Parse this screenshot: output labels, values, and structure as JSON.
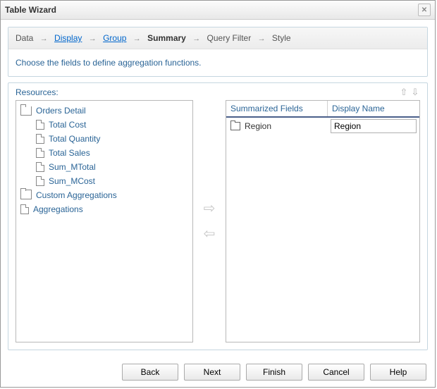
{
  "window": {
    "title": "Table Wizard"
  },
  "breadcrumb": {
    "data": "Data",
    "display": "Display",
    "group": "Group",
    "summary": "Summary",
    "query_filter": "Query Filter",
    "style": "Style"
  },
  "instruction": "Choose the fields to define aggregation functions.",
  "resources_label": "Resources:",
  "tree": {
    "orders_detail": "Orders Detail",
    "items": [
      "Total Cost",
      "Total Quantity",
      "Total Sales",
      "Sum_MTotal",
      "Sum_MCost"
    ],
    "custom_aggregations": "Custom Aggregations",
    "aggregations": "Aggregations"
  },
  "table": {
    "header_summarized": "Summarized Fields",
    "header_display": "Display Name",
    "rows": [
      {
        "field": "Region",
        "display": "Region"
      }
    ]
  },
  "buttons": {
    "back": "Back",
    "next": "Next",
    "finish": "Finish",
    "cancel": "Cancel",
    "help": "Help"
  }
}
